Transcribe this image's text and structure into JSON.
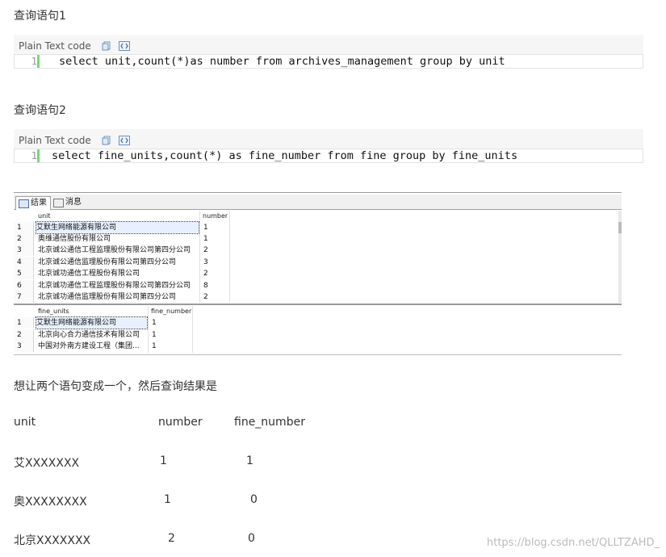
{
  "heading1": "查询语句1",
  "heading2": "查询语句2",
  "code1": {
    "lang_label": "Plain Text code",
    "line_no": "1",
    "code": "select unit,count(*)as number from archives_management group by unit"
  },
  "code2": {
    "lang_label": "Plain Text code",
    "line_no": "1",
    "code": "select fine_units,count(*) as fine_number from fine group by fine_units"
  },
  "ssms": {
    "tabs": [
      {
        "label": "结果",
        "icon": "grid-icon"
      },
      {
        "label": "消息",
        "icon": "message-icon"
      }
    ],
    "grid1": {
      "columns": [
        "unit",
        "number"
      ],
      "rows": [
        {
          "n": "1",
          "unit": "艾默生网络能源有限公司",
          "number": "1"
        },
        {
          "n": "2",
          "unit": "奥维通信股份有限公司",
          "number": "1"
        },
        {
          "n": "3",
          "unit": "北京诚公通信工程监理股份有限公司第四分公司",
          "number": "2"
        },
        {
          "n": "4",
          "unit": "北京诚公通信监理股份有限公司第四分公司",
          "number": "3"
        },
        {
          "n": "5",
          "unit": "北京诚功通信工程股份有限公司",
          "number": "2"
        },
        {
          "n": "6",
          "unit": "北京诚功通信工程监理股份有限公司第四分公司",
          "number": "8"
        },
        {
          "n": "7",
          "unit": "北京诚功通信监理股份有限公司第四分公司",
          "number": "2"
        }
      ]
    },
    "grid2": {
      "columns": [
        "fine_units",
        "fine_number"
      ],
      "rows": [
        {
          "n": "1",
          "unit": "艾默生网络能源有限公司",
          "number": "1"
        },
        {
          "n": "2",
          "unit": "北京向心合力通信技术有限公司",
          "number": "1"
        },
        {
          "n": "3",
          "unit": "中国对外南方建设工程（集团...",
          "number": "1"
        }
      ]
    }
  },
  "question": "想让两个语句变成一个，然后查询结果是",
  "result": {
    "headers": [
      "unit",
      "number",
      "fine_number"
    ],
    "rows": [
      [
        "艾XXXXXXX",
        "1",
        "1"
      ],
      [
        "奥XXXXXXXX",
        "1",
        "0"
      ],
      [
        "北京XXXXXXX",
        "2",
        "0"
      ]
    ]
  },
  "watermark": "https://blog.csdn.net/QLLTZAHD_"
}
